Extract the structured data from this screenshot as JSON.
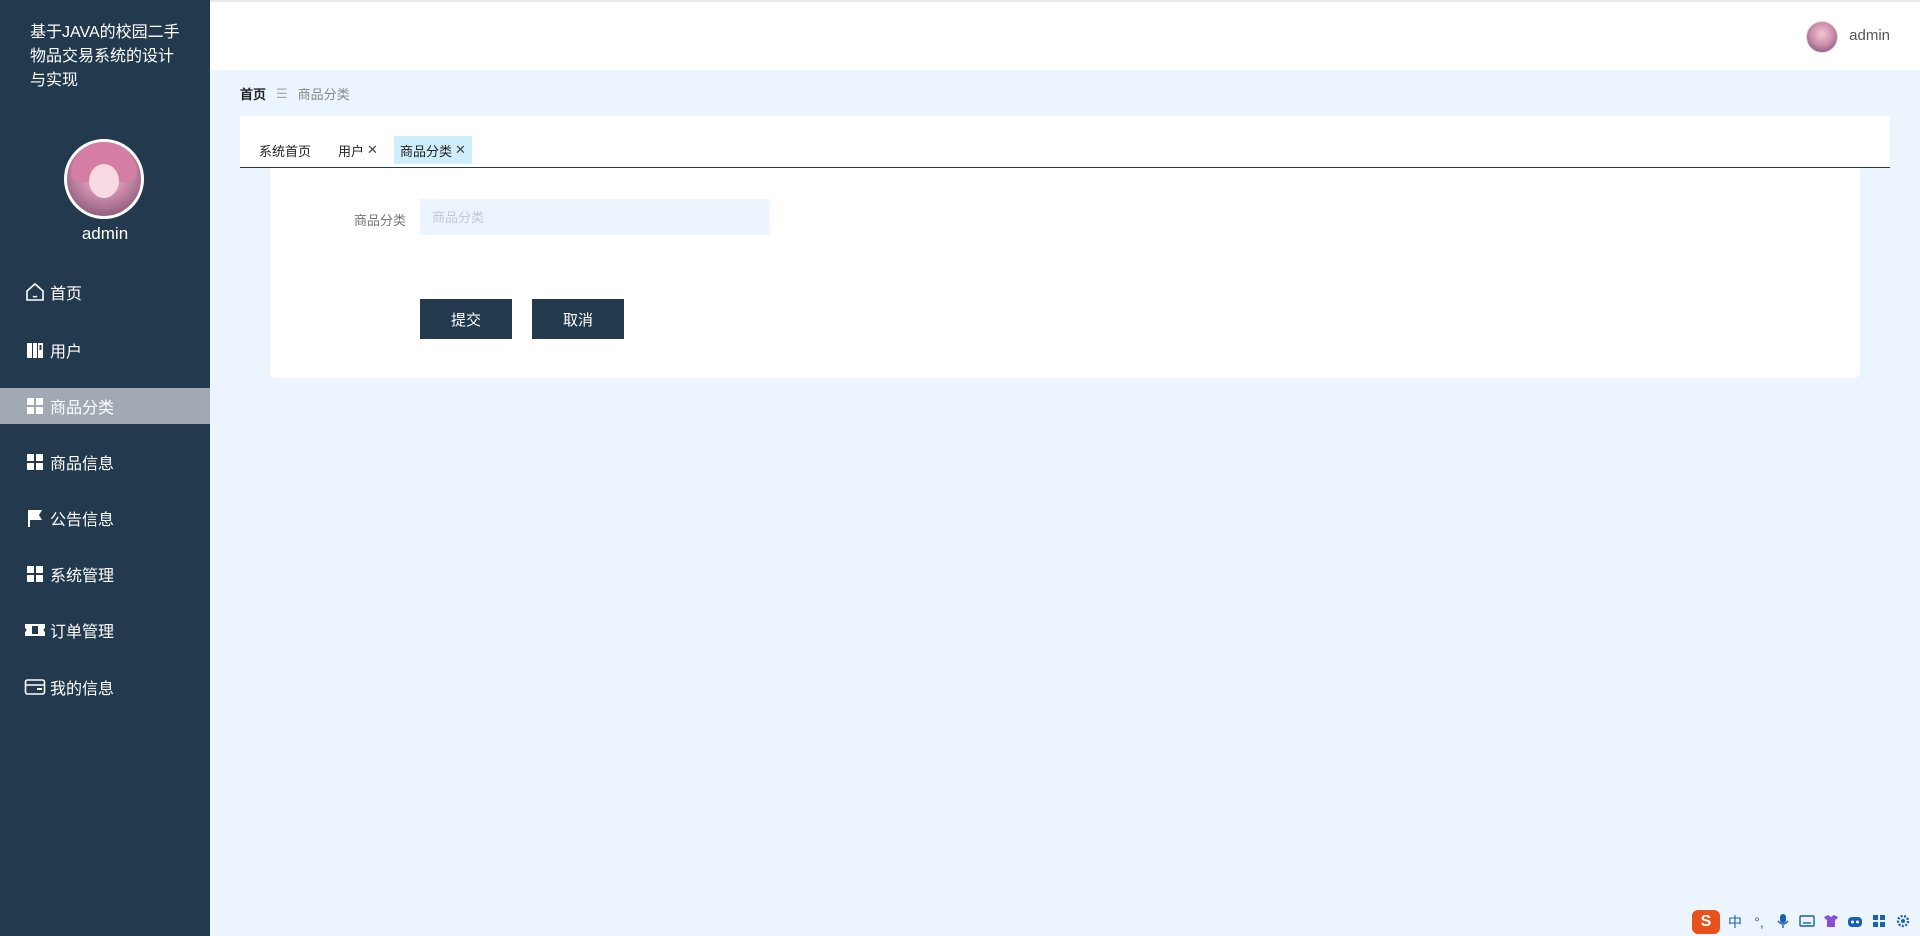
{
  "app": {
    "title": "基于JAVA的校园二手物品交易系统的设计与实现"
  },
  "sidebar": {
    "username": "admin",
    "items": [
      {
        "label": "首页",
        "icon": "home-icon",
        "active": false
      },
      {
        "label": "用户",
        "icon": "book-icon",
        "active": false
      },
      {
        "label": "商品分类",
        "icon": "grid-icon",
        "active": true
      },
      {
        "label": "商品信息",
        "icon": "grid-icon",
        "active": false
      },
      {
        "label": "公告信息",
        "icon": "flag-icon",
        "active": false
      },
      {
        "label": "系统管理",
        "icon": "grid-icon",
        "active": false
      },
      {
        "label": "订单管理",
        "icon": "ticket-icon",
        "active": false
      },
      {
        "label": "我的信息",
        "icon": "card-icon",
        "active": false
      }
    ]
  },
  "header": {
    "username": "admin"
  },
  "breadcrumb": {
    "home": "首页",
    "separator": "☰",
    "current": "商品分类"
  },
  "tabs": [
    {
      "label": "系统首页",
      "closable": false,
      "active": false
    },
    {
      "label": "用户",
      "closable": true,
      "active": false
    },
    {
      "label": "商品分类",
      "closable": true,
      "active": true
    }
  ],
  "form": {
    "field_label": "商品分类",
    "field_placeholder": "商品分类",
    "field_value": "",
    "submit_label": "提交",
    "cancel_label": "取消"
  },
  "tray": {
    "logo": "S",
    "lang": "中",
    "items": [
      "°,",
      "mic-icon",
      "keyboard-icon",
      "shirt-icon",
      "bot-icon",
      "apps-icon",
      "settings-icon"
    ]
  },
  "colors": {
    "sidebar_bg": "#233a4e",
    "active_menu_bg": "#a1aab3",
    "page_bg": "#ecf5fd",
    "active_tab_bg": "#cdeefa",
    "button_bg": "#233a4e"
  }
}
